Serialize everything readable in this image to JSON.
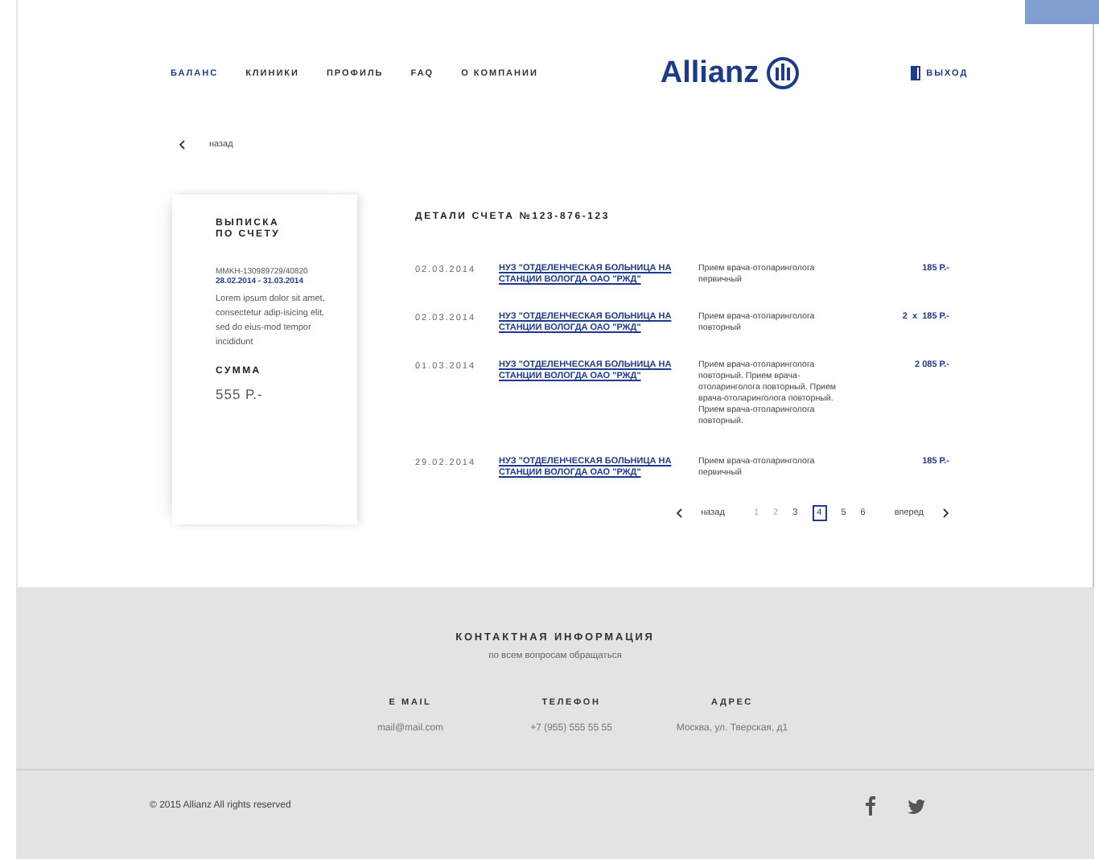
{
  "nav": [
    {
      "label": "БАЛАНС",
      "selected": true
    },
    {
      "label": "КЛИНИКИ",
      "selected": false
    },
    {
      "label": "ПРОФИЛЬ",
      "selected": false
    },
    {
      "label": "FAQ",
      "selected": false
    },
    {
      "label": "О КОМПАНИИ",
      "selected": false
    }
  ],
  "logo": "Allianz",
  "logout": "ВЫХОД",
  "back": "назад",
  "statement": {
    "title_lines": [
      "ВЫПИСКА",
      "ПО СЧЕТУ"
    ],
    "account": "MMKH-130989729/40820",
    "period": "28.02.2014 - 31.03.2014",
    "description": "Lorem ipsum dolor sit amet, consectetur adip-isicing elit, sed do eius-mod tempor incididunt",
    "sum_label": "СУММА",
    "sum": "555 Р.-"
  },
  "details": {
    "title": "ДЕТАЛИ СЧЕТА №123-876-123",
    "rows": [
      {
        "date": "02.03.2014",
        "clinic": "НУЗ \"ОТДЕЛЕНЧЕСКАЯ БОЛЬНИЦА НА СТАНЦИИ ВОЛОГДА ОАО \"РЖД\"",
        "service": "Прием врача-отоларинголога первичный",
        "amount": "185 Р.-"
      },
      {
        "date": "02.03.2014",
        "clinic": "НУЗ \"ОТДЕЛЕНЧЕСКАЯ БОЛЬНИЦА НА СТАНЦИИ ВОЛОГДА ОАО \"РЖД\"",
        "service": "Прием врача-отоларинголога повторный",
        "amount": "2  x  185 Р.-"
      },
      {
        "date": "01.03.2014",
        "clinic": "НУЗ \"ОТДЕЛЕНЧЕСКАЯ БОЛЬНИЦА НА СТАНЦИИ ВОЛОГДА ОАО \"РЖД\"",
        "service": "Прием врача-отоларинголога повторный. Прием врача-отоларинголога повторный. Прием врача-отоларинголога повторный. Прием врача-отоларинголога повторный.",
        "amount": "2 085 Р.-"
      },
      {
        "date": "29.02.2014",
        "clinic": "НУЗ \"ОТДЕЛЕНЧЕСКАЯ БОЛЬНИЦА НА СТАНЦИИ ВОЛОГДА ОАО \"РЖД\"",
        "service": "Прием врача-отоларинголога первичный",
        "amount": "185 Р.-"
      }
    ]
  },
  "pagination": {
    "prev": "назад",
    "next": "вперед",
    "pages": [
      {
        "label": "1",
        "selected": false
      },
      {
        "label": "2",
        "selected": false
      },
      {
        "label": "3",
        "selected": false
      },
      {
        "label": "4",
        "selected": true
      },
      {
        "label": "5",
        "selected": false
      },
      {
        "label": "6",
        "selected": false
      }
    ]
  },
  "contacts": {
    "title": "КОНТАКТНАЯ ИНФОРМАЦИЯ",
    "subtitle": "по всем вопросам обращаться",
    "columns": [
      {
        "label": "E MAIL",
        "value": "mail@mail.com"
      },
      {
        "label": "ТЕЛЕФОН",
        "value": "+7 (955) 555 55 55"
      },
      {
        "label": "АДРЕС",
        "value": "Москва, ул. Тверская, д1"
      }
    ]
  },
  "copyright": "© 2015 Allianz All rights reserved"
}
